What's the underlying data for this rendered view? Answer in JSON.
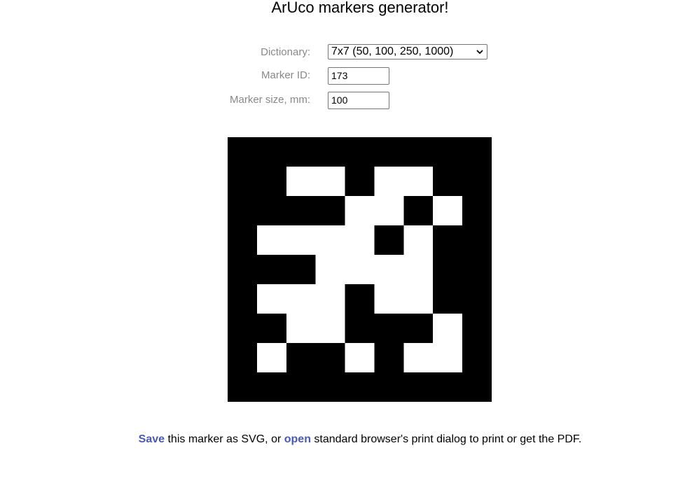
{
  "page": {
    "title": "ArUco markers generator!"
  },
  "form": {
    "dictionary_label": "Dictionary:",
    "dictionary_value": "7x7 (50, 100, 250, 1000)",
    "marker_id_label": "Marker ID:",
    "marker_id_value": "173",
    "marker_size_label": "Marker size, mm:",
    "marker_size_value": "100"
  },
  "marker": {
    "grid": [
      "000000000",
      "001101100",
      "000011010",
      "011110100",
      "000111100",
      "011101100",
      "001100010",
      "010010110",
      "000000000"
    ],
    "black": "#000000",
    "white": "#ffffff"
  },
  "footer": {
    "save_link": "Save",
    "text_1": " this marker as SVG, or ",
    "open_link": "open",
    "text_2": " standard browser's print dialog to print or get the PDF."
  },
  "colors": {
    "label": "#888888",
    "link": "#4a5ca8"
  }
}
